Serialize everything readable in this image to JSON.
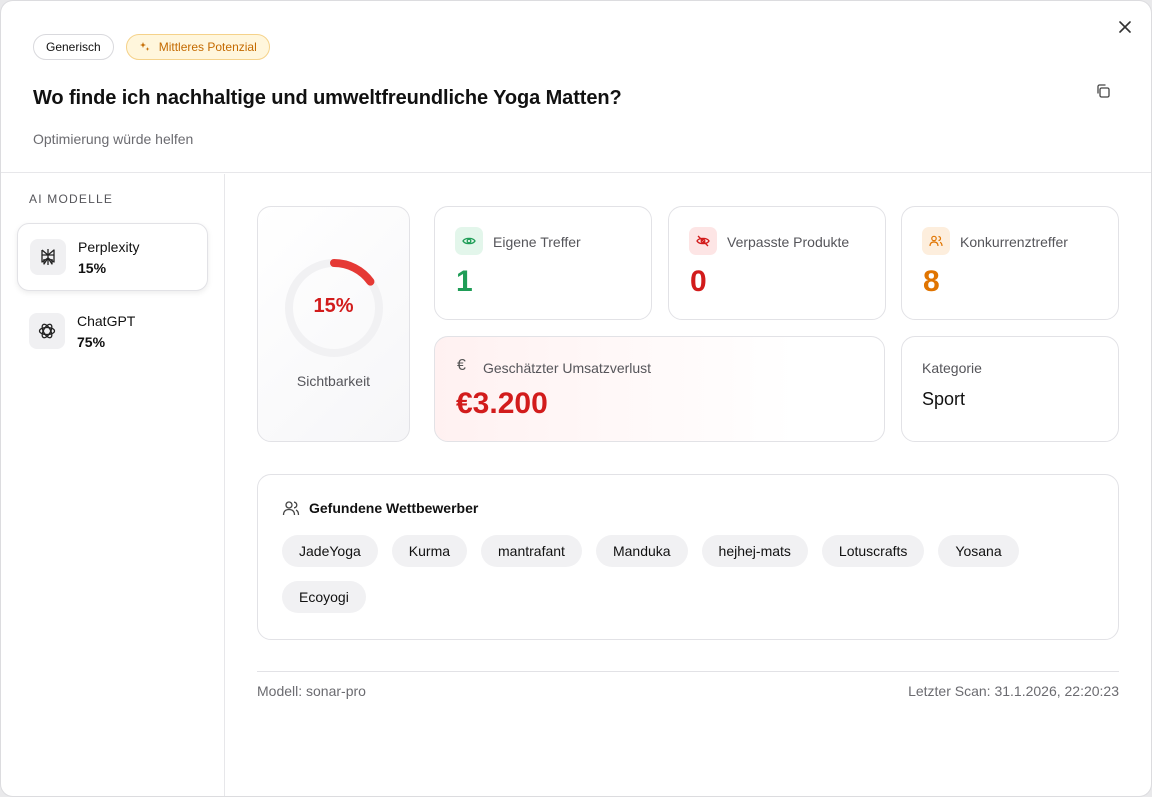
{
  "header": {
    "badge_generic": "Generisch",
    "badge_potential": "Mittleres Potenzial",
    "title": "Wo finde ich nachhaltige und umweltfreundliche Yoga Matten?",
    "subtitle": "Optimierung würde helfen"
  },
  "sidebar": {
    "heading": "AI MODELLE",
    "models": [
      {
        "name": "Perplexity",
        "pct": "15%",
        "icon": "perplexity-icon"
      },
      {
        "name": "ChatGPT",
        "pct": "75%",
        "icon": "chatgpt-icon"
      }
    ]
  },
  "visibility": {
    "value_label": "15%",
    "fraction": 0.15,
    "caption": "Sichtbarkeit",
    "color": "#e53935"
  },
  "stats": [
    {
      "label": "Eigene Treffer",
      "value": "1",
      "color": "#1f9d57",
      "icon": "eye-icon"
    },
    {
      "label": "Verpasste Produkte",
      "value": "0",
      "color": "#d21c1c",
      "icon": "eye-off-icon"
    },
    {
      "label": "Konkurrenztreffer",
      "value": "8",
      "color": "#e07400",
      "icon": "users-icon"
    }
  ],
  "loss": {
    "label": "Geschätzter Umsatzverlust",
    "value": "€3.200",
    "icon": "euro-icon"
  },
  "category": {
    "label": "Kategorie",
    "value": "Sport"
  },
  "competitors": {
    "heading": "Gefundene Wettbewerber",
    "items": [
      "JadeYoga",
      "Kurma",
      "mantrafant",
      "Manduka",
      "hejhej-mats",
      "Lotuscrafts",
      "Yosana",
      "Ecoyogi"
    ]
  },
  "footer": {
    "model": "Modell: sonar-pro",
    "last_scan": "Letzter Scan: 31.1.2026, 22:20:23"
  }
}
